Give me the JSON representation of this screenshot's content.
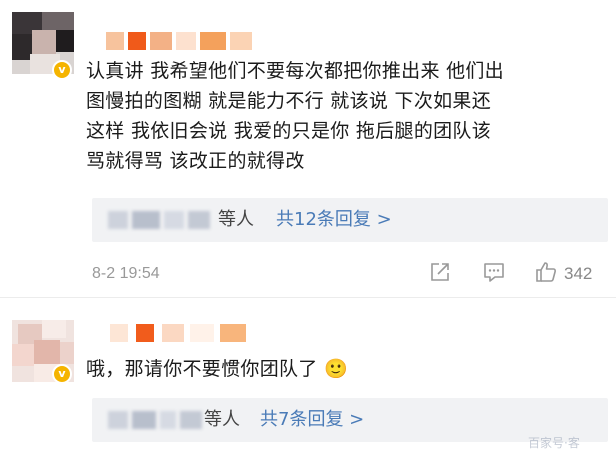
{
  "comments": [
    {
      "text_lines": [
        "认真讲 我希望他们不要每次都把你推出来 他们出",
        "图慢拍的图糊 就是能力不行 就该说 下次如果还",
        "这样 我依旧会说 我爱的只是你 拖后腿的团队该",
        "骂就得骂 该改正的就得改"
      ],
      "verified_mark": "v",
      "replies": {
        "suffix": "等人",
        "link": "共12条回复 >"
      },
      "time": "8-2 19:54",
      "like_count": "342",
      "icons": [
        "share-icon",
        "comment-icon",
        "like-icon"
      ]
    },
    {
      "text_lines": [
        "哦，那请你不要惯你团队了 🙂"
      ],
      "verified_mark": "v",
      "replies": {
        "suffix": "等人",
        "link": "共7条回复 >"
      }
    }
  ],
  "watermark": "百家号·客"
}
